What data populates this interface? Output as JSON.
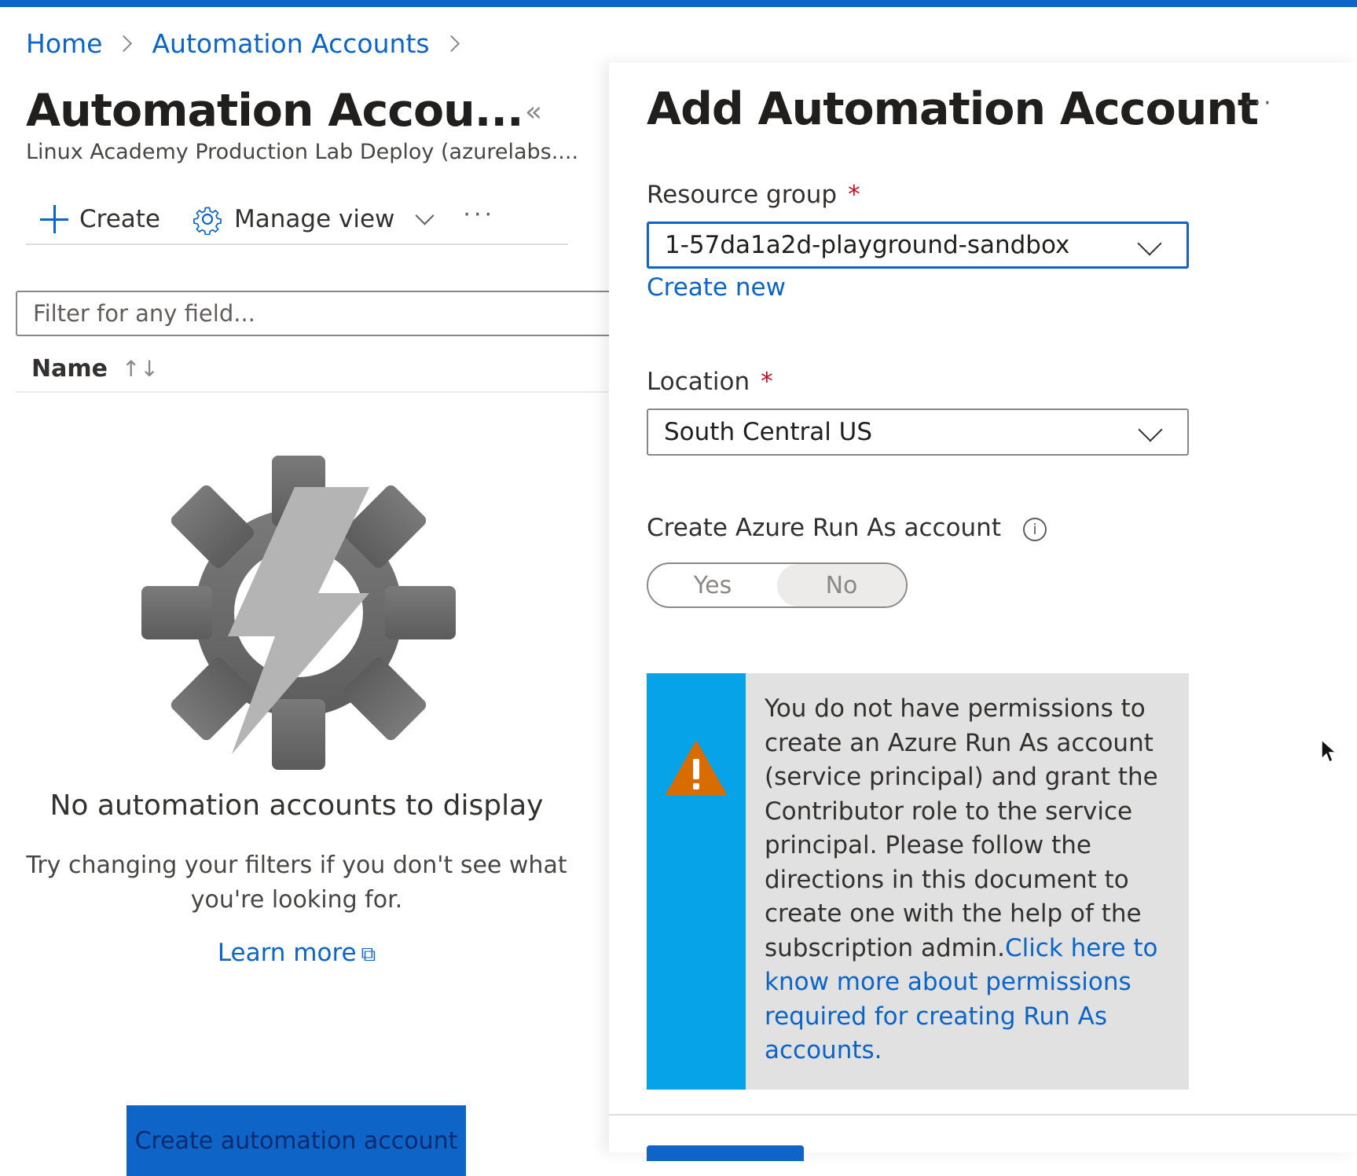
{
  "breadcrumb": {
    "home": "Home",
    "automation_accounts": "Automation Accounts"
  },
  "left": {
    "title": "Automation Accou...",
    "collapse_icon": "«",
    "subtitle": "Linux Academy Production Lab Deploy (azurelabs....",
    "toolbar": {
      "create": "Create",
      "manage_view": "Manage view",
      "more": "···"
    },
    "filter_placeholder": "Filter for any field...",
    "column_name": "Name",
    "sort_icon": "↑↓",
    "empty_title": "No automation accounts to display",
    "empty_subtitle": "Try changing your filters if you don't see what you're looking for.",
    "learn_more": "Learn more",
    "external_icon": "⧉",
    "cta": "Create automation account"
  },
  "right": {
    "title": "Add Automation Account",
    "more": "···",
    "resource_group_label": "Resource group",
    "required_mark": "*",
    "resource_group_value": "1-57da1a2d-playground-sandbox",
    "create_new": "Create new",
    "location_label": "Location",
    "location_value": "South Central US",
    "run_as_label": "Create Azure Run As account",
    "info_icon": "i",
    "toggle_yes": "Yes",
    "toggle_no": "No",
    "toggle_selected": "No",
    "warning_text": "You do not have permissions to create an Azure Run As account (service principal) and grant the Contributor role to the service principal. Please follow the directions in this document to create one with the help of the subscription admin.",
    "warning_link": "Click here to know more about permissions required for creating Run As accounts."
  },
  "colors": {
    "accent": "#0f64c8",
    "link": "#0a64c9",
    "warning_bar": "#07a3e8",
    "warning_bg": "#e1e1e1",
    "warning_icon": "#d86c00",
    "required": "#c50f1f"
  },
  "icons": {
    "create": "plus-icon",
    "manage_view": "gear-icon",
    "empty_state": "automation-gear-bolt-icon",
    "warning": "warning-triangle-icon"
  }
}
